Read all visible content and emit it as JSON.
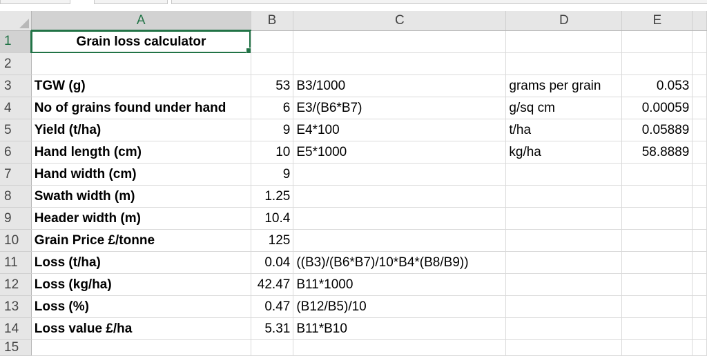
{
  "sheet": {
    "columns": [
      "A",
      "B",
      "C",
      "D",
      "E"
    ],
    "rows": [
      {
        "num": "1",
        "a": "Grain loss calculator",
        "b": "",
        "c": "",
        "d": "",
        "e": ""
      },
      {
        "num": "2",
        "a": "",
        "b": "",
        "c": "",
        "d": "",
        "e": ""
      },
      {
        "num": "3",
        "a": "TGW (g)",
        "b": "53",
        "c": "B3/1000",
        "d": "grams per grain",
        "e": "0.053"
      },
      {
        "num": "4",
        "a": "No of grains found under hand",
        "b": "6",
        "c": "E3/(B6*B7)",
        "d": "g/sq cm",
        "e": "0.00059"
      },
      {
        "num": "5",
        "a": "Yield (t/ha)",
        "b": "9",
        "c": "E4*100",
        "d": "t/ha",
        "e": "0.05889"
      },
      {
        "num": "6",
        "a": "Hand length (cm)",
        "b": "10",
        "c": "E5*1000",
        "d": "kg/ha",
        "e": "58.8889"
      },
      {
        "num": "7",
        "a": "Hand width (cm)",
        "b": "9",
        "c": "",
        "d": "",
        "e": ""
      },
      {
        "num": "8",
        "a": "Swath width (m)",
        "b": "1.25",
        "c": "",
        "d": "",
        "e": ""
      },
      {
        "num": "9",
        "a": "Header width (m)",
        "b": "10.4",
        "c": "",
        "d": "",
        "e": ""
      },
      {
        "num": "10",
        "a": "Grain Price £/tonne",
        "b": "125",
        "c": "",
        "d": "",
        "e": ""
      },
      {
        "num": "11",
        "a": "Loss (t/ha)",
        "b": "0.04",
        "c": "((B3)/(B6*B7)/10*B4*(B8/B9))",
        "d": "",
        "e": ""
      },
      {
        "num": "12",
        "a": "Loss (kg/ha)",
        "b": "42.47",
        "c": "B11*1000",
        "d": "",
        "e": ""
      },
      {
        "num": "13",
        "a": "Loss (%)",
        "b": "0.47",
        "c": "(B12/B5)/10",
        "d": "",
        "e": ""
      },
      {
        "num": "14",
        "a": "Loss value £/ha",
        "b": "5.31",
        "c": "B11*B10",
        "d": "",
        "e": ""
      },
      {
        "num": "15",
        "a": "",
        "b": "",
        "c": "",
        "d": "",
        "e": ""
      }
    ]
  }
}
